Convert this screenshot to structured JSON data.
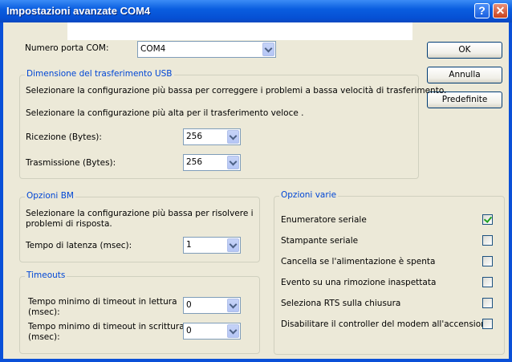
{
  "window": {
    "title": "Impostazioni avanzate COM4",
    "help_label": "?",
    "close_label": "✕"
  },
  "com_port": {
    "label": "Numero porta COM:",
    "value": "COM4"
  },
  "buttons": {
    "ok": "OK",
    "cancel": "Annulla",
    "defaults": "Predefinite"
  },
  "usb": {
    "title": "Dimensione del trasferimento USB",
    "hint_low": "Selezionare la configurazione più bassa per correggere i problemi a bassa velocità di trasferimento.",
    "hint_high": "Selezionare la configurazione più alta per il trasferimento veloce .",
    "receive_label": "Ricezione (Bytes):",
    "receive_value": "256",
    "transmit_label": "Trasmissione (Bytes):",
    "transmit_value": "256"
  },
  "bm": {
    "title": "Opzioni BM",
    "hint_line1": "Selezionare la configurazione più bassa per risolvere i",
    "hint_line2": "problemi di risposta.",
    "latency_label": "Tempo di latenza (msec):",
    "latency_value": "1"
  },
  "timeouts": {
    "title": "Timeouts",
    "read_label_line1": "Tempo minimo di timeout in lettura",
    "read_label_line2": "(msec):",
    "read_value": "0",
    "write_label_line1": "Tempo minimo di timeout in scrittura",
    "write_label_line2": "(msec):",
    "write_value": "0"
  },
  "misc": {
    "title": "Opzioni varie",
    "options": [
      {
        "label": "Enumeratore seriale",
        "checked": true
      },
      {
        "label": "Stampante seriale",
        "checked": false
      },
      {
        "label": "Cancella se l'alimentazione è spenta",
        "checked": false
      },
      {
        "label": "Evento su una rimozione inaspettata",
        "checked": false
      },
      {
        "label": "Seleziona RTS sulla chiusura",
        "checked": false
      },
      {
        "label": "Disabilitare il controller del modem all'accensione",
        "checked": false
      }
    ]
  }
}
